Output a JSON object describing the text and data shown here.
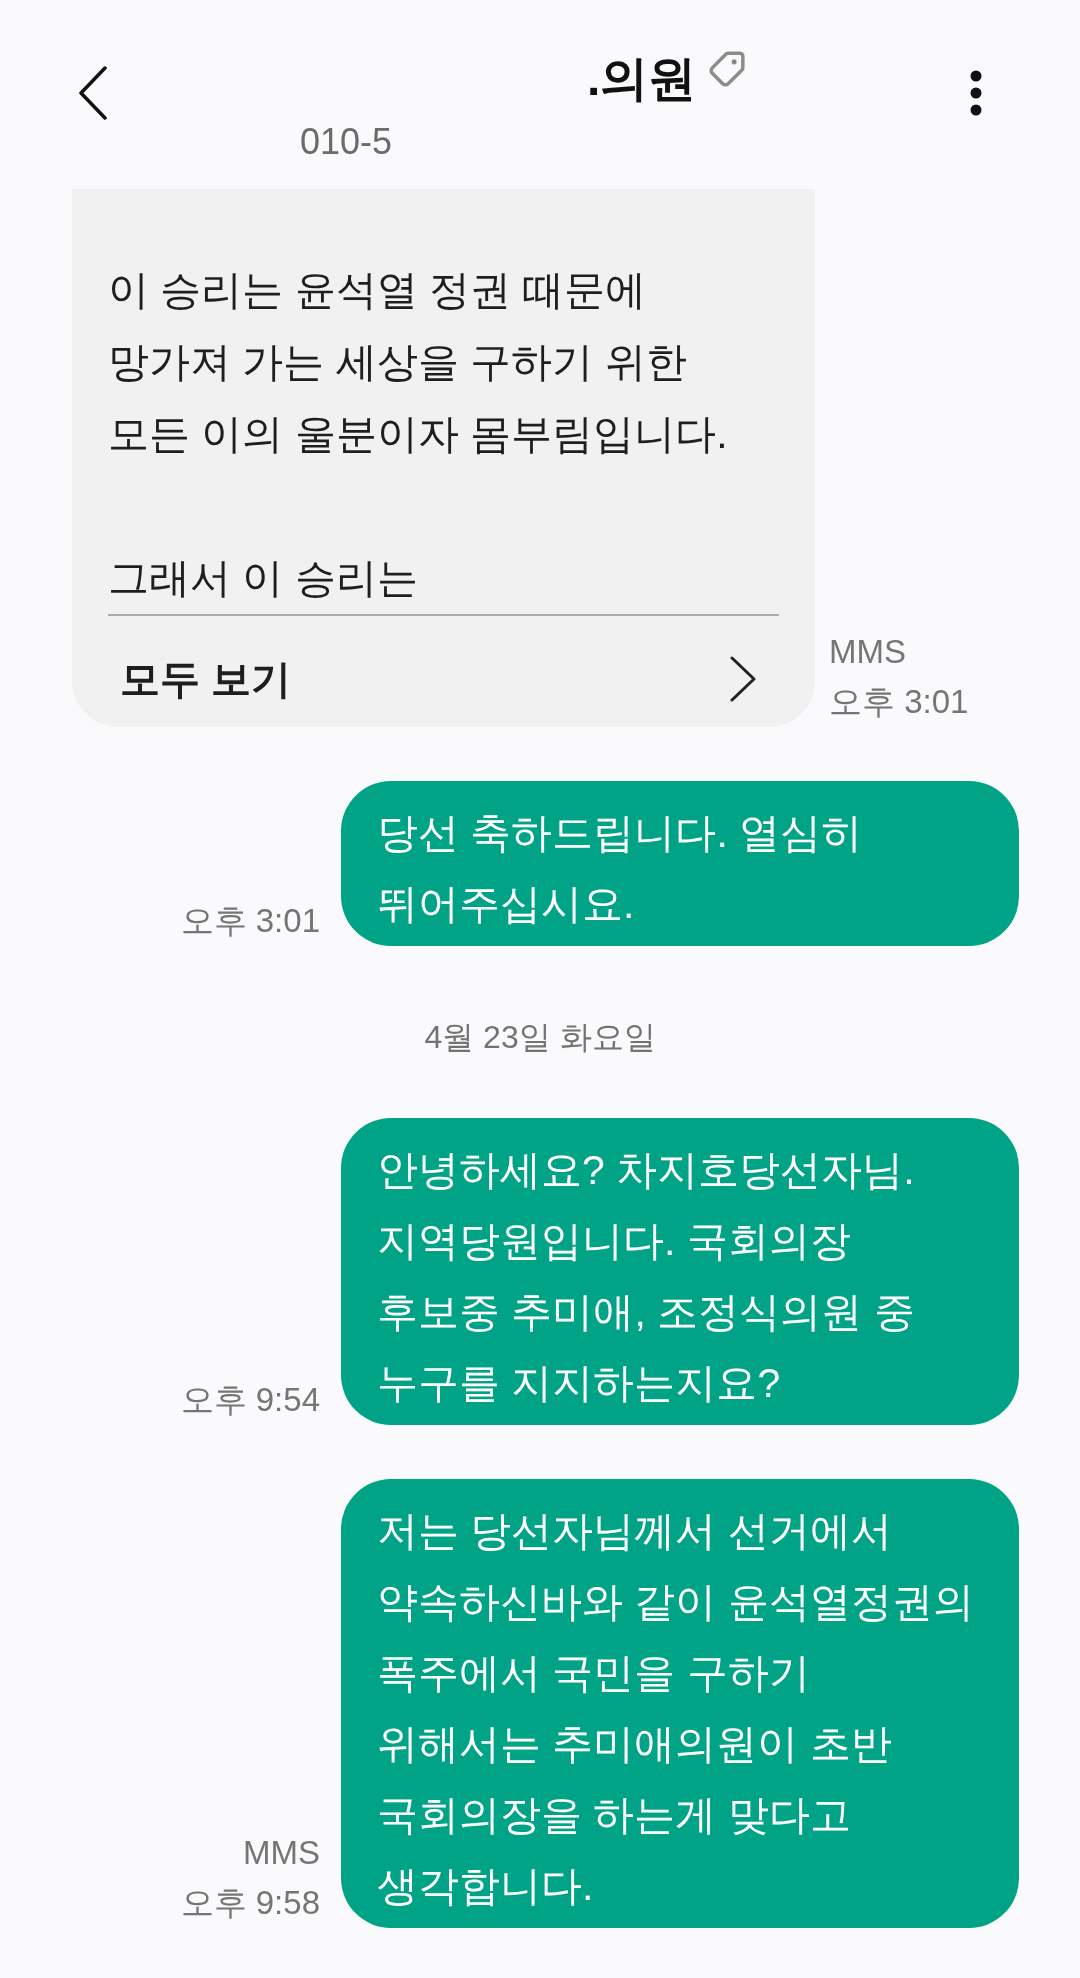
{
  "header": {
    "title": ".의원",
    "phone": "010-5"
  },
  "messages": [
    {
      "kind": "received",
      "text": "이 승리는 윤석열 정권 때문에\n망가져 가는 세상을 구하기 위한\n모든 이의 울분이자 몸부림입니다.\n\n그래서 이 승리는",
      "expand_label": "모두 보기",
      "label": "MMS",
      "time": "오후 3:01"
    },
    {
      "kind": "sent",
      "text": "당선 축하드립니다. 열심히\n뛰어주십시요.",
      "time": "오후 3:01"
    },
    {
      "kind": "date",
      "text": "4월 23일 화요일"
    },
    {
      "kind": "sent",
      "text": "안녕하세요? 차지호당선자님.\n지역당원입니다. 국회의장\n후보중 추미애, 조정식의원 중\n누구를 지지하는지요?",
      "time": "오후 9:54"
    },
    {
      "kind": "sent",
      "text": "저는 당선자님께서 선거에서\n약속하신바와 같이 윤석열정권의\n폭주에서 국민을 구하기\n위해서는 추미애의원이 초반\n국회의장을 하는게 맞다고\n생각합니다.",
      "label": "MMS",
      "time": "오후 9:58"
    }
  ]
}
